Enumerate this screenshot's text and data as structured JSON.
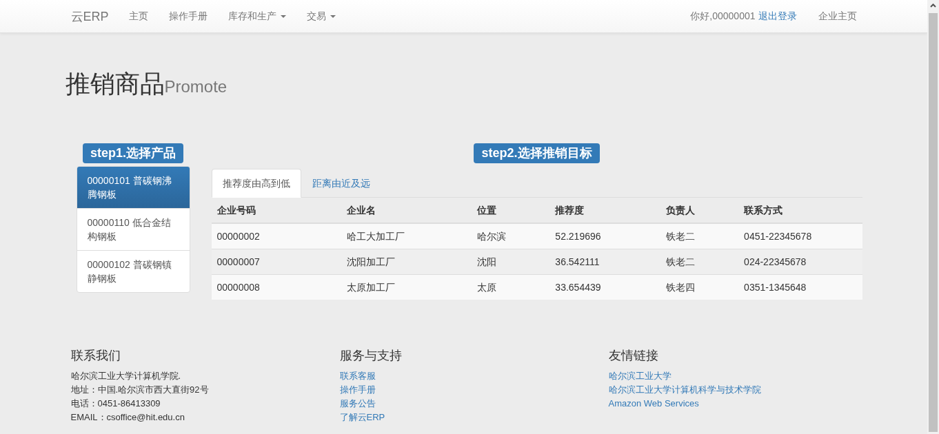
{
  "navbar": {
    "brand": "云ERP",
    "items": [
      {
        "label": "主页",
        "dropdown": false
      },
      {
        "label": "操作手册",
        "dropdown": false
      },
      {
        "label": "库存和生产",
        "dropdown": true
      },
      {
        "label": "交易",
        "dropdown": true
      }
    ],
    "greeting": "你好,00000001",
    "logout": "退出登录",
    "right_link": "企业主页"
  },
  "header": {
    "title": "推销商品",
    "subtitle": "Promote"
  },
  "step1": {
    "label": "step1.选择产品",
    "products": [
      {
        "label": "00000101 普碳钢沸腾钢板",
        "selected": true
      },
      {
        "label": "00000110 低合金结构钢板",
        "selected": false
      },
      {
        "label": "00000102 普碳钢镇静钢板",
        "selected": false
      }
    ]
  },
  "step2": {
    "label": "step2.选择推销目标",
    "tabs": [
      {
        "label": "推荐度由高到低",
        "selected": true
      },
      {
        "label": "距离由近及远",
        "selected": false
      }
    ],
    "table": {
      "columns": [
        "企业号码",
        "企业名",
        "位置",
        "推荐度",
        "负责人",
        "联系方式"
      ],
      "rows": [
        [
          "00000002",
          "哈工大加工厂",
          "哈尔滨",
          "52.219696",
          "铁老二",
          "0451-22345678"
        ],
        [
          "00000007",
          "沈阳加工厂",
          "沈阳",
          "36.542111",
          "铁老二",
          "024-22345678"
        ],
        [
          "00000008",
          "太原加工厂",
          "太原",
          "33.654439",
          "铁老四",
          "0351-1345648"
        ]
      ]
    }
  },
  "footer": [
    {
      "title": "联系我们",
      "kind": "text",
      "lines": [
        "哈尔滨工业大学计算机学院.",
        "地址：中国.哈尔滨市西大直街92号",
        "电话：0451-86413309",
        "EMAIL：csoffice@hit.edu.cn"
      ]
    },
    {
      "title": "服务与支持",
      "kind": "links",
      "lines": [
        "联系客服",
        "操作手册",
        "服务公告",
        "了解云ERP"
      ]
    },
    {
      "title": "友情链接",
      "kind": "links",
      "lines": [
        "哈尔滨工业大学",
        "哈尔滨工业大学计算机科学与技术学院",
        "Amazon Web Services"
      ]
    }
  ]
}
